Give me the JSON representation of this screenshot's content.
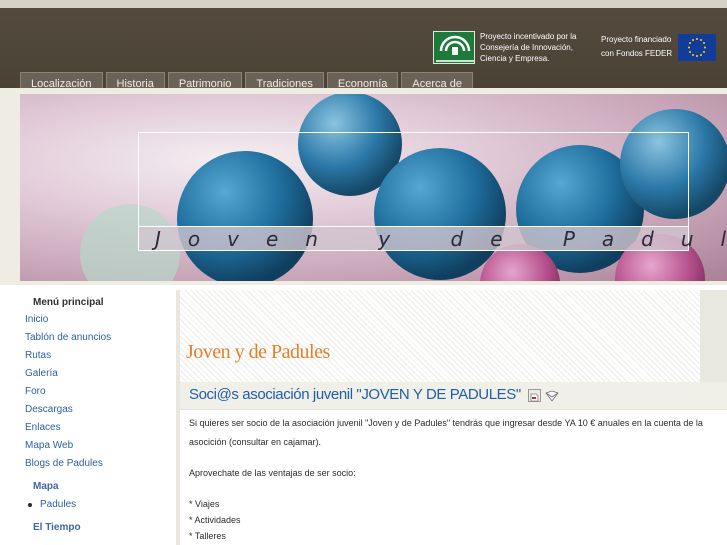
{
  "nav": {
    "items": [
      "Localización",
      "Historia",
      "Patrimonio",
      "Tradiciones",
      "Economía",
      "Acerca de"
    ]
  },
  "sponsors": {
    "junta_logo_icon": "junta-de-andalucia-logo",
    "incentivado_text": "Proyecto incentivado por la Consejería de Innovación, Ciencia y Empresa.",
    "financiado_text": "Proyecto financiado con Fondos FEDER",
    "eu_flag_icon": "eu-flag"
  },
  "banner": {
    "title": "Joven y de Padules"
  },
  "sidebar": {
    "menu_heading": "Menú principal",
    "menu_items": [
      "Inicio",
      "Tablón de anuncios",
      "Rutas",
      "Galería",
      "Foro",
      "Descargas",
      "Enlaces",
      "Mapa Web",
      "Blogs de Padules"
    ],
    "mapa_heading": "Mapa",
    "mapa_items": [
      "Padules"
    ],
    "tiempo_heading": "El Tiempo"
  },
  "main": {
    "site_title": "Joven y de Padules",
    "article": {
      "title": "Soci@s asociación juvenil \"JOVEN Y DE PADULES\"",
      "pdf_icon": "pdf-icon",
      "email_icon": "email-icon",
      "paragraph1": "Si quieres ser socio de la asociación juvenil \"Joven y de Padules\" tendrás que ingresar desde YA 10 € anuales en la cuenta de la asocición (consultar en cajamar).",
      "paragraph2": "Aprovechate de las ventajas de ser socio:",
      "benefits": [
        "* Viajes",
        "* Actividades",
        "* Talleres"
      ]
    }
  },
  "colors": {
    "header_bg": "#4d4337",
    "nav_tab_bg": "#6a6256",
    "site_title": "#e0802a",
    "link_blue": "#2b5fa3",
    "article_title": "#1f5ea8"
  }
}
